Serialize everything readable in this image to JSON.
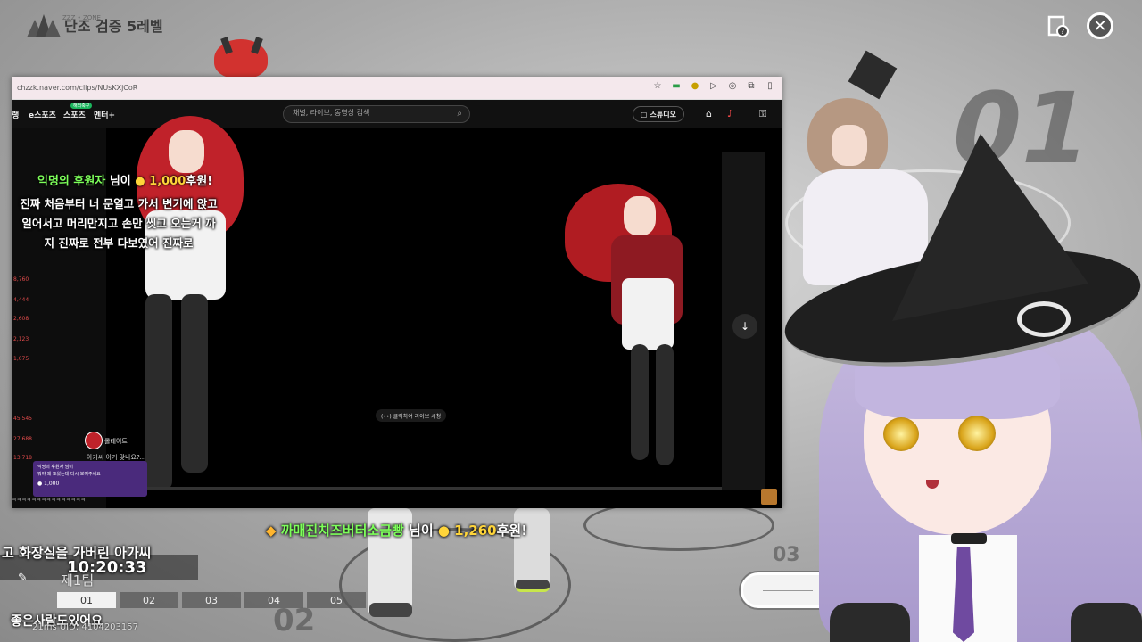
{
  "game": {
    "logo_sub": "ZZZ • ZONE",
    "title": "단조 검증 5레벨",
    "stage_numbers": [
      "01",
      "02",
      "03"
    ],
    "stage_label": "제1팀",
    "tabs": [
      "01",
      "02",
      "03",
      "04",
      "05"
    ],
    "active_tab": "01",
    "uid_text": "21ms  UID: 4104203157"
  },
  "browser": {
    "url": "chzzk.naver.com/clips/NUsKXjCoR",
    "nav": [
      "랭",
      "e스포츠",
      "스포츠",
      "멘터+"
    ],
    "nav_badge": "해외축구",
    "search_placeholder": "채널, 라이브, 동영상 검색",
    "studio_label": "스튜디오",
    "live_chip": "(••) 클릭하여 라이브 시청",
    "rail_numbers": [
      "8,760",
      "4,444",
      "2,608",
      "2,123",
      "1,075",
      "45,545",
      "27,688",
      "13,718"
    ],
    "chat_nick": "롤레이트",
    "chat_line": "아가씨 이거 맞나요?...",
    "chat_bottom": "ㅋㅋㅋㅋㅋㅋㅋㅋㅋㅋㅋㅋㅋㅋㅋ",
    "popup_name": "익명의 후원자 님이",
    "popup_msg": "뭐야 왜 또왔는데 다시 보여주세요",
    "popup_amount": "● 1,000"
  },
  "overlay": {
    "donation1": {
      "nick": "익명의 후원자",
      "suffix": " 님이 ",
      "amount": "1,000",
      "unit": "후원!"
    },
    "donation1_msg": "진짜 처음부터 너 문열고 가서 변기에 앉고 일어서고 머리만지고 손만 씻고 오는거 까지 진짜로 전부 다보였어 진짜로",
    "donation2": {
      "nick": "까매진치즈버터소금빵",
      "suffix": " 님이 ",
      "amount": "1,260",
      "unit": "후원!"
    },
    "caption": "고 화장실을 가버린 아가씨",
    "clock": "10:20:33",
    "bottom_msg": "좋은사람도있어요"
  },
  "colors": {
    "donor_green": "#7dff5a",
    "amount_yellow": "#ffd53a",
    "site_dark": "#111111"
  }
}
